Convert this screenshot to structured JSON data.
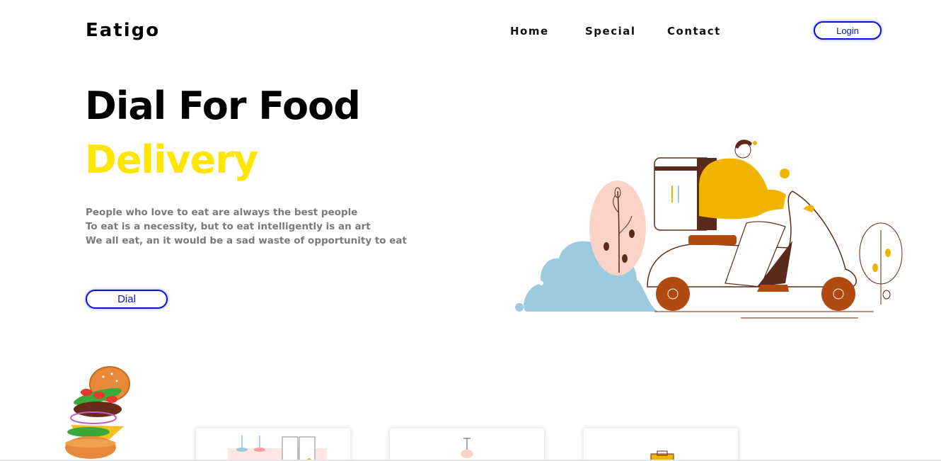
{
  "header": {
    "logo": "Eatigo",
    "nav": [
      "Home",
      "Special",
      "Contact"
    ],
    "login_label": "Login"
  },
  "hero": {
    "title": "Dial For Food",
    "subtitle": "Delivery",
    "tagline": [
      "People who love to eat are always the best people",
      "To eat is a necessity, but to eat intelligently is an art",
      "We all eat, an it would be a sad waste of opportunity to eat"
    ],
    "dial_label": "Dial"
  },
  "colors": {
    "accent_yellow": "#ffe600",
    "button_blue": "#0a12d8",
    "muted_text": "#7a7a7a"
  },
  "illustrations": {
    "hero": "scooter-delivery-illustration",
    "burger": "floating-burger-illustration",
    "cards": [
      "restaurant-menu-illustration",
      "lamp-illustration",
      "food-box-illustration"
    ]
  }
}
